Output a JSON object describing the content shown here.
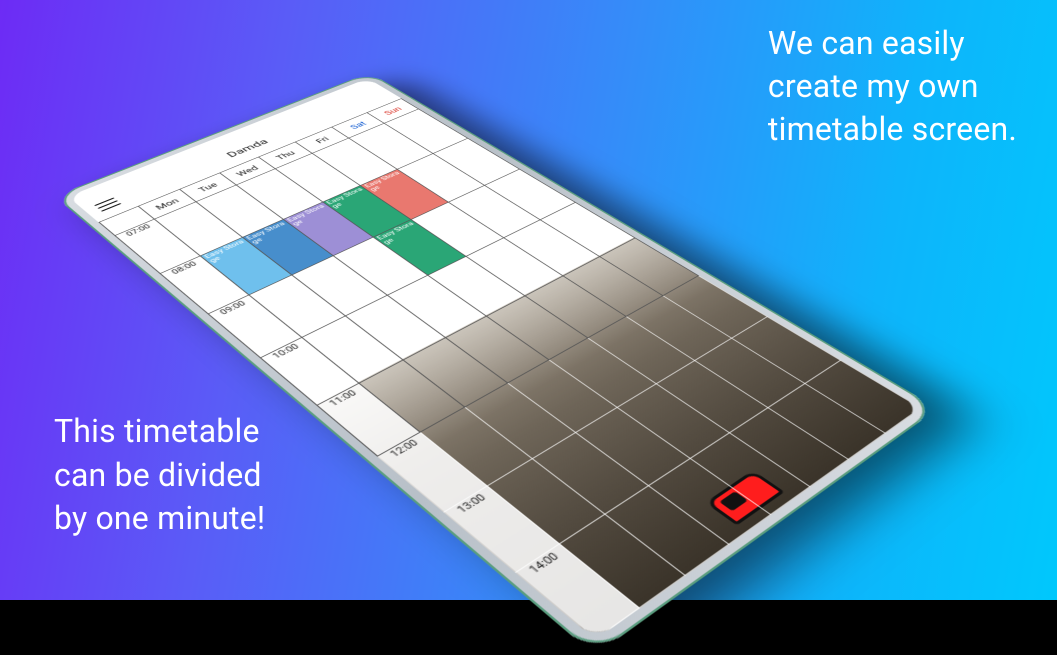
{
  "captions": {
    "top": "We can easily\ncreate my own\ntimetable screen.",
    "bottom": "This timetable\ncan be divided\nby one minute!"
  },
  "app": {
    "title": "Damda"
  },
  "days": [
    "Mon",
    "Tue",
    "Wed",
    "Thu",
    "Fri",
    "Sat",
    "Sun"
  ],
  "times": [
    "07:00",
    "08:00",
    "09:00",
    "10:00",
    "11:00",
    "12:00",
    "13:00",
    "14:00"
  ],
  "timetable": {
    "event_label": "Easy Storage",
    "events": [
      {
        "day": "Mon",
        "start": "08:00",
        "color": "c1"
      },
      {
        "day": "Tue",
        "start": "08:00",
        "color": "c2"
      },
      {
        "day": "Wed",
        "start": "08:00",
        "color": "c3"
      },
      {
        "day": "Thu",
        "start": "08:00",
        "color": "c4"
      },
      {
        "day": "Fri",
        "start": "08:00",
        "color": "c5"
      },
      {
        "day": "Thu",
        "start": "09:00",
        "color": "c4"
      }
    ]
  }
}
